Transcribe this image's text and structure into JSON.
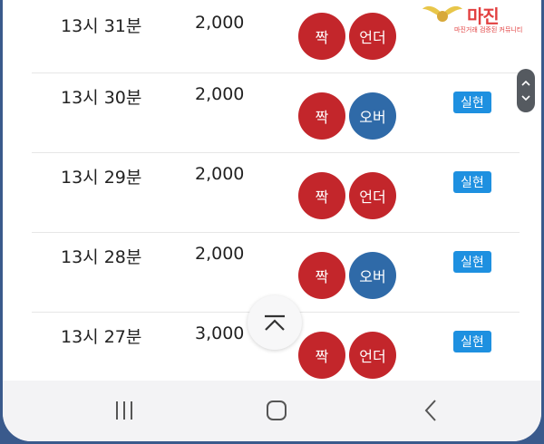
{
  "rows": [
    {
      "time": "13시 31분",
      "amount": "2,000",
      "ball1": {
        "label": "짝",
        "color": "red"
      },
      "ball2": {
        "label": "언더",
        "color": "red"
      },
      "badge": ""
    },
    {
      "time": "13시 30분",
      "amount": "2,000",
      "ball1": {
        "label": "짝",
        "color": "red"
      },
      "ball2": {
        "label": "오버",
        "color": "blue"
      },
      "badge": "실현"
    },
    {
      "time": "13시 29분",
      "amount": "2,000",
      "ball1": {
        "label": "짝",
        "color": "red"
      },
      "ball2": {
        "label": "언더",
        "color": "red"
      },
      "badge": "실현"
    },
    {
      "time": "13시 28분",
      "amount": "2,000",
      "ball1": {
        "label": "짝",
        "color": "red"
      },
      "ball2": {
        "label": "오버",
        "color": "blue"
      },
      "badge": "실현"
    },
    {
      "time": "13시 27분",
      "amount": "3,000",
      "ball1": {
        "label": "짝",
        "color": "red"
      },
      "ball2": {
        "label": "언더",
        "color": "red"
      },
      "badge": "실현"
    }
  ],
  "watermark": {
    "title": "마진",
    "subtitle": "마진거래 검증된 커뮤니티"
  },
  "icons": {
    "scroll_up": "chevron-up-icon",
    "scroll_down": "chevron-down-icon",
    "back_to_top": "chevron-up-icon",
    "recents": "recents-icon",
    "home": "home-icon",
    "back": "back-icon"
  },
  "colors": {
    "red_ball": "#c3262b",
    "blue_ball": "#2f6aa8",
    "badge": "#1e90e0",
    "frame": "#3a5a8c"
  }
}
